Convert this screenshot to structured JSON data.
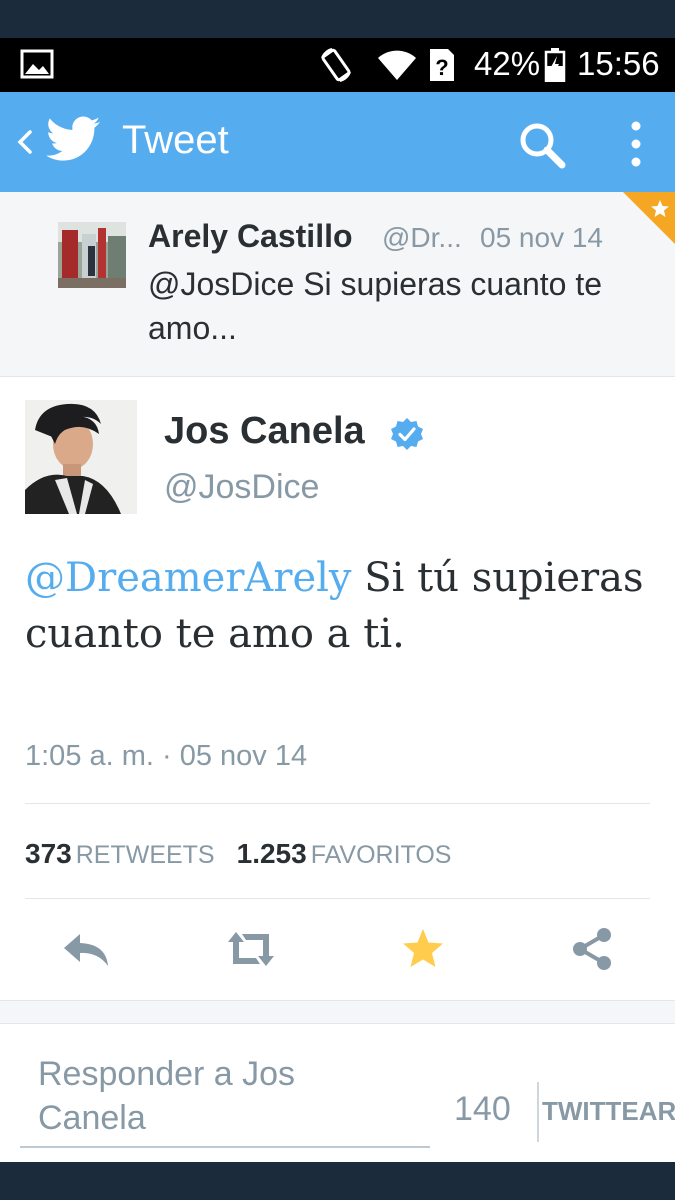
{
  "status_bar": {
    "battery_percent": "42%",
    "time": "15:56",
    "icons": [
      "gallery-icon",
      "screen-rotate-icon",
      "wifi-icon",
      "sim-unknown-icon",
      "battery-charging-icon"
    ]
  },
  "app_bar": {
    "title": "Tweet",
    "icons": [
      "back-icon",
      "twitter-bird-icon",
      "search-icon",
      "more-vert-icon"
    ],
    "background": "#55acee"
  },
  "parent_tweet": {
    "name": "Arely Castillo",
    "handle": "@Dr...",
    "date": "05 nov 14",
    "text": "@JosDice Si supieras cuanto te amo..."
  },
  "tweet": {
    "name": "Jos Canela",
    "verified": true,
    "handle": "@JosDice",
    "mention": "@DreamerArely",
    "text_after_mention": " Si tú supieras cuanto te amo a ti.",
    "timestamp": "1:05 a. m. · 05 nov 14",
    "retweets_count": "373",
    "retweets_label": "RETWEETS",
    "favorites_count": "1.253",
    "favorites_label": "FAVORITOS"
  },
  "actions": [
    "reply-icon",
    "retweet-icon",
    "favorite-icon",
    "share-icon"
  ],
  "reply_box": {
    "placeholder_line1": "Responder a Jos",
    "placeholder_line2": "Canela",
    "char_count": "140",
    "button_label": "TWITTEAR"
  },
  "colors": {
    "twitter_blue": "#55acee",
    "favorite_star": "#ffcc4d",
    "text_dark": "#292f33",
    "text_gray": "#8899a6"
  }
}
